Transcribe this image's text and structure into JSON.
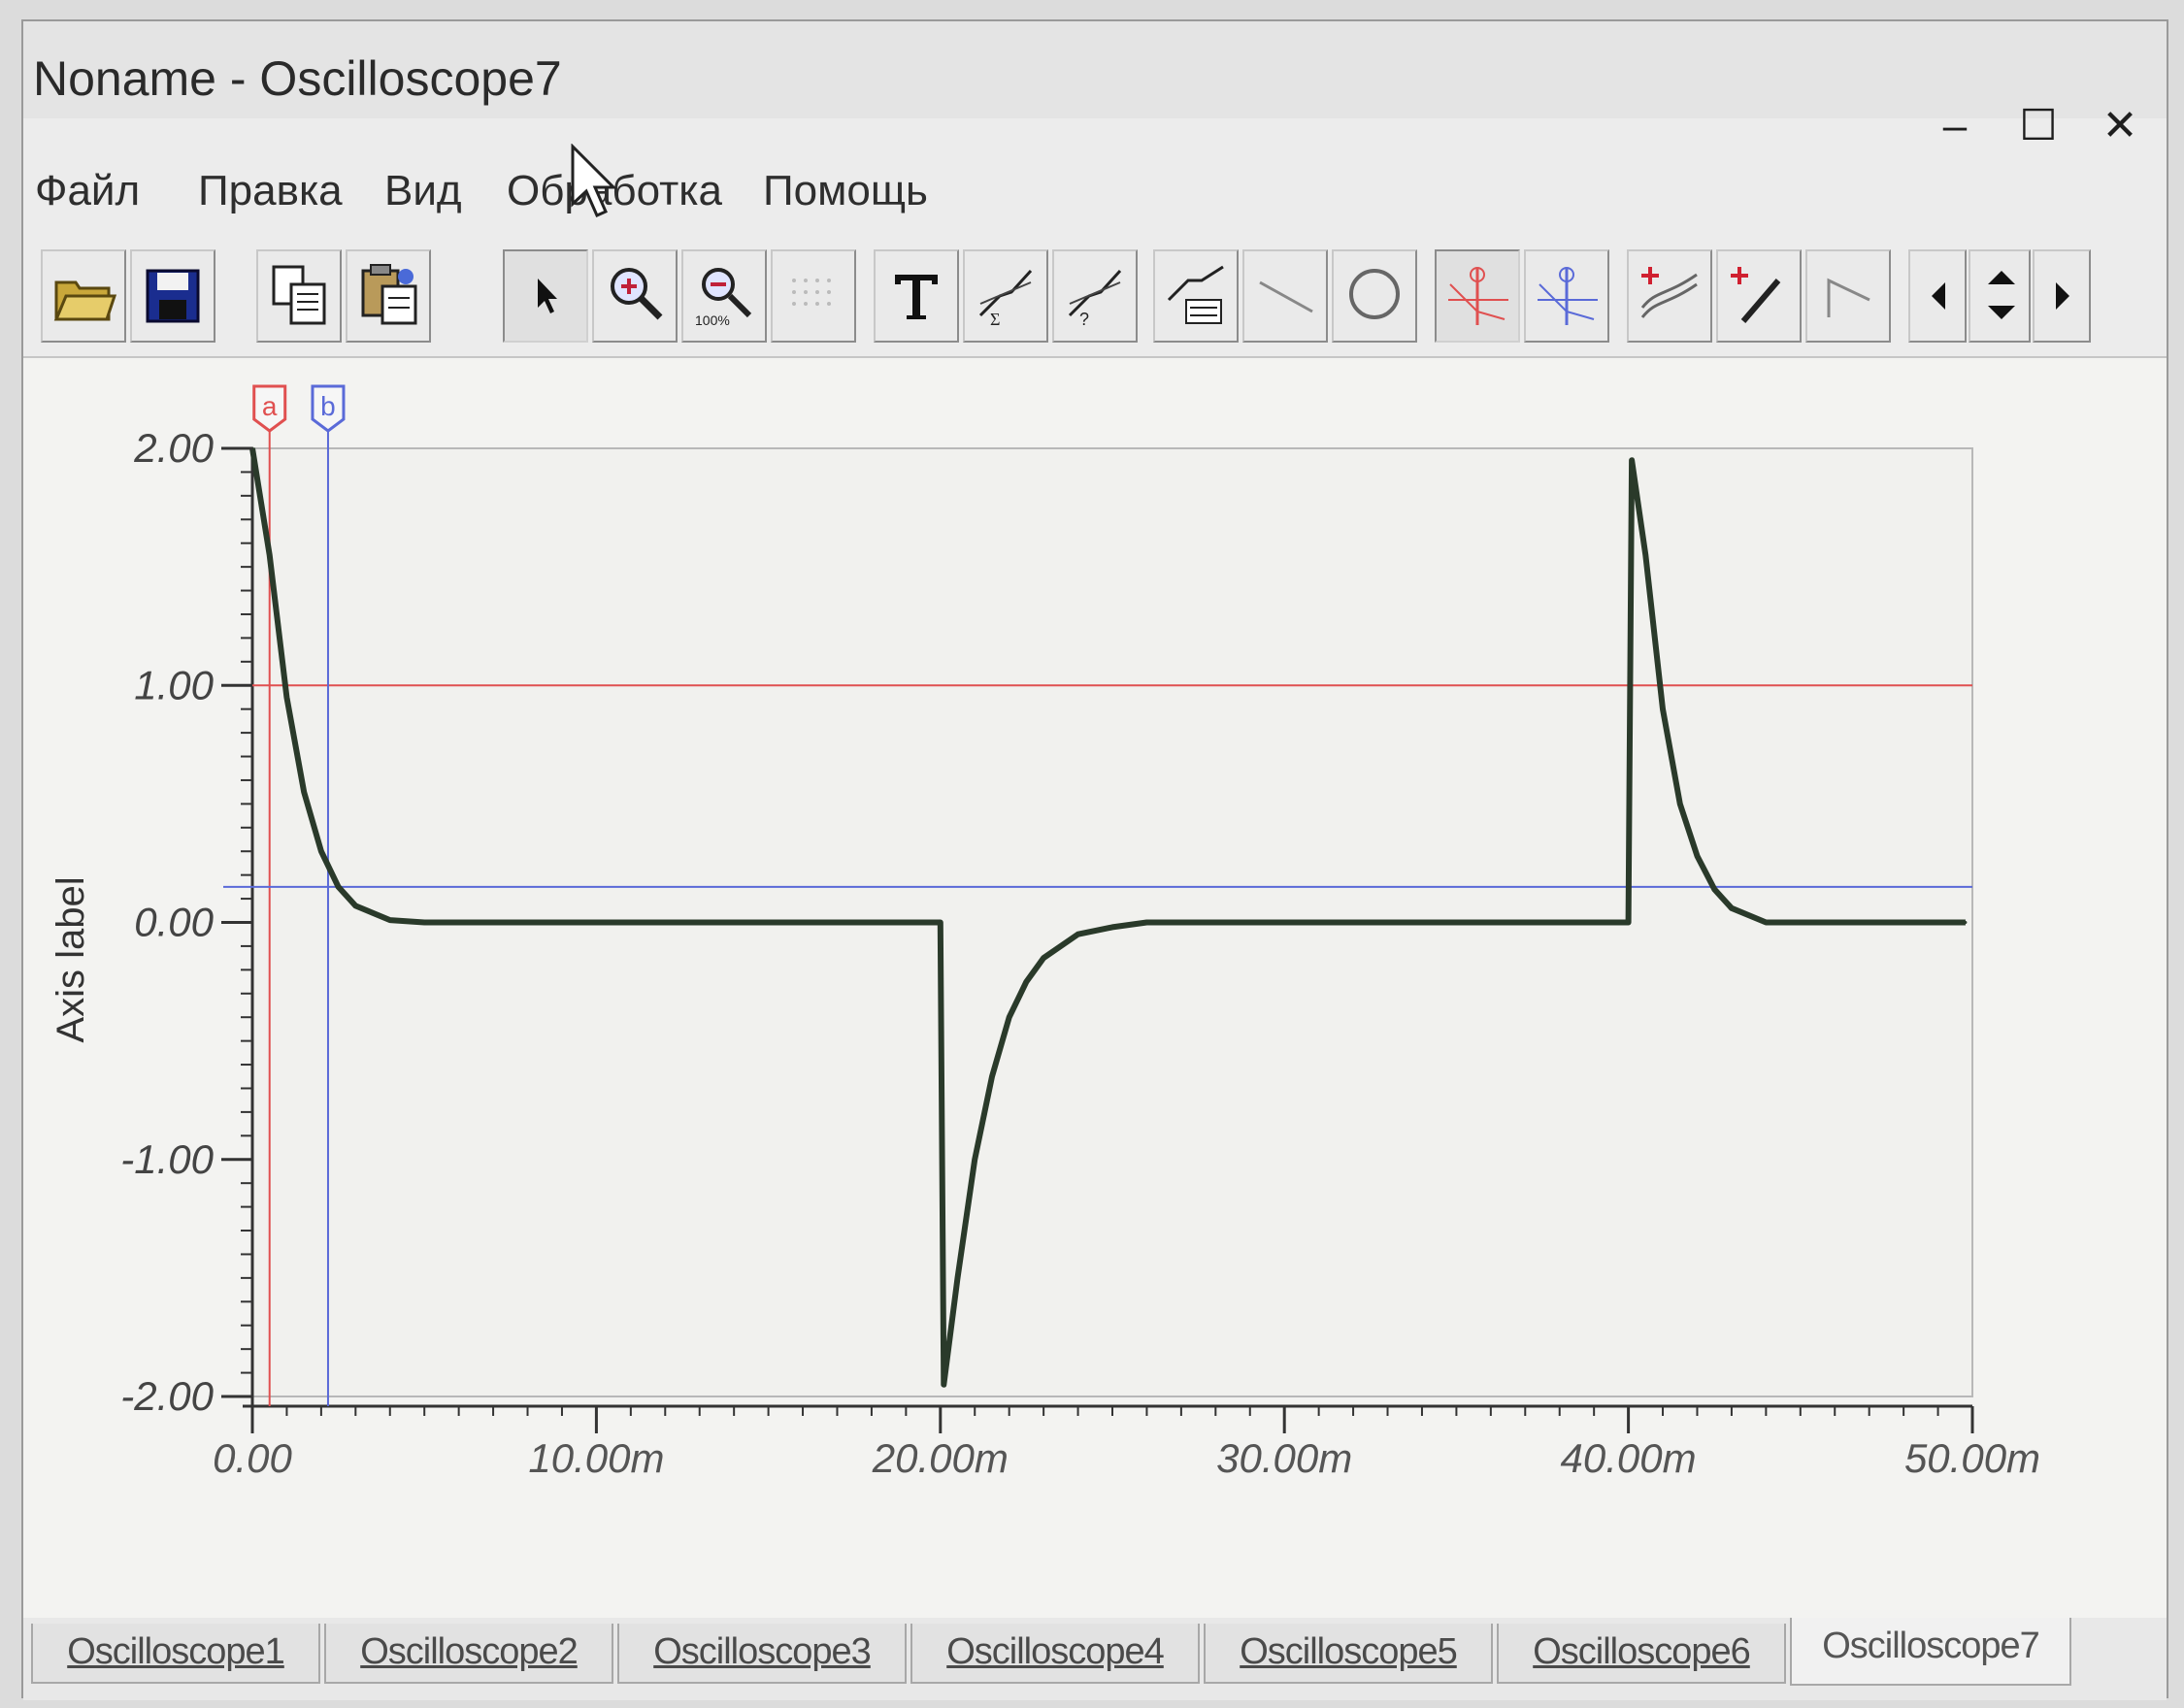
{
  "window": {
    "title": "Noname - Oscilloscope7",
    "minimize": "–",
    "maximize": "☐",
    "close": "✕"
  },
  "menu": [
    "Файл",
    "Правка",
    "Вид",
    "Обработка",
    "Помощь"
  ],
  "toolbar": {
    "icons": [
      "open-folder-icon",
      "save-disk-icon",
      "copy-icon",
      "paste-icon",
      "select-arrow-icon",
      "zoom-in-icon",
      "zoom-100-icon",
      "grid-icon",
      "text-icon",
      "measure-x-icon",
      "measure-y-icon",
      "measure-table-icon",
      "line-icon",
      "circle-icon",
      "cursor-a-icon",
      "cursor-b-icon",
      "add-trace-icon",
      "pick-point-icon",
      "ramp-icon",
      "arrow-left-icon",
      "arrow-up-down-icon",
      "arrow-right-icon"
    ],
    "zoom100_label": "100%"
  },
  "chart_data": {
    "type": "line",
    "title": "",
    "xlabel": "",
    "ylabel": "Axis label",
    "xlim": [
      0,
      0.05
    ],
    "ylim": [
      -2,
      2
    ],
    "x_ticks": [
      {
        "value": 0,
        "label": "0.00"
      },
      {
        "value": 0.01,
        "label": "10.00m"
      },
      {
        "value": 0.02,
        "label": "20.00m"
      },
      {
        "value": 0.03,
        "label": "30.00m"
      },
      {
        "value": 0.04,
        "label": "40.00m"
      },
      {
        "value": 0.05,
        "label": "50.00m"
      }
    ],
    "y_ticks": [
      {
        "value": 2,
        "label": "2.00"
      },
      {
        "value": 1,
        "label": "1.00"
      },
      {
        "value": 0,
        "label": "0.00"
      },
      {
        "value": -1,
        "label": "-1.00"
      },
      {
        "value": -2,
        "label": "-2.00"
      }
    ],
    "grid": true,
    "series": [
      {
        "color": "#2a3a2a",
        "x": [
          0,
          0.0005,
          0.001,
          0.0015,
          0.002,
          0.0025,
          0.003,
          0.004,
          0.005,
          0.02,
          0.0201,
          0.0205,
          0.021,
          0.0215,
          0.022,
          0.0225,
          0.023,
          0.024,
          0.025,
          0.026,
          0.04,
          0.0401,
          0.0405,
          0.041,
          0.0415,
          0.042,
          0.0425,
          0.043,
          0.044,
          0.045,
          0.0498
        ],
        "y": [
          2.0,
          1.55,
          0.95,
          0.55,
          0.3,
          0.15,
          0.07,
          0.01,
          0.0,
          0.0,
          -1.95,
          -1.5,
          -1.0,
          -0.65,
          -0.4,
          -0.25,
          -0.15,
          -0.05,
          -0.02,
          0.0,
          0.0,
          1.95,
          1.55,
          0.9,
          0.5,
          0.28,
          0.14,
          0.06,
          0.0,
          0.0,
          0.0
        ]
      }
    ],
    "cursors": [
      {
        "label": "a",
        "x": 0.0005,
        "y": 1.0,
        "color": "#e05050"
      },
      {
        "label": "b",
        "x": 0.0022,
        "y": 0.15,
        "color": "#5a6ad8"
      }
    ]
  },
  "tabs": [
    "Oscilloscope1",
    "Oscilloscope2",
    "Oscilloscope3",
    "Oscilloscope4",
    "Oscilloscope5",
    "Oscilloscope6",
    "Oscilloscope7"
  ],
  "active_tab": "Oscilloscope7"
}
